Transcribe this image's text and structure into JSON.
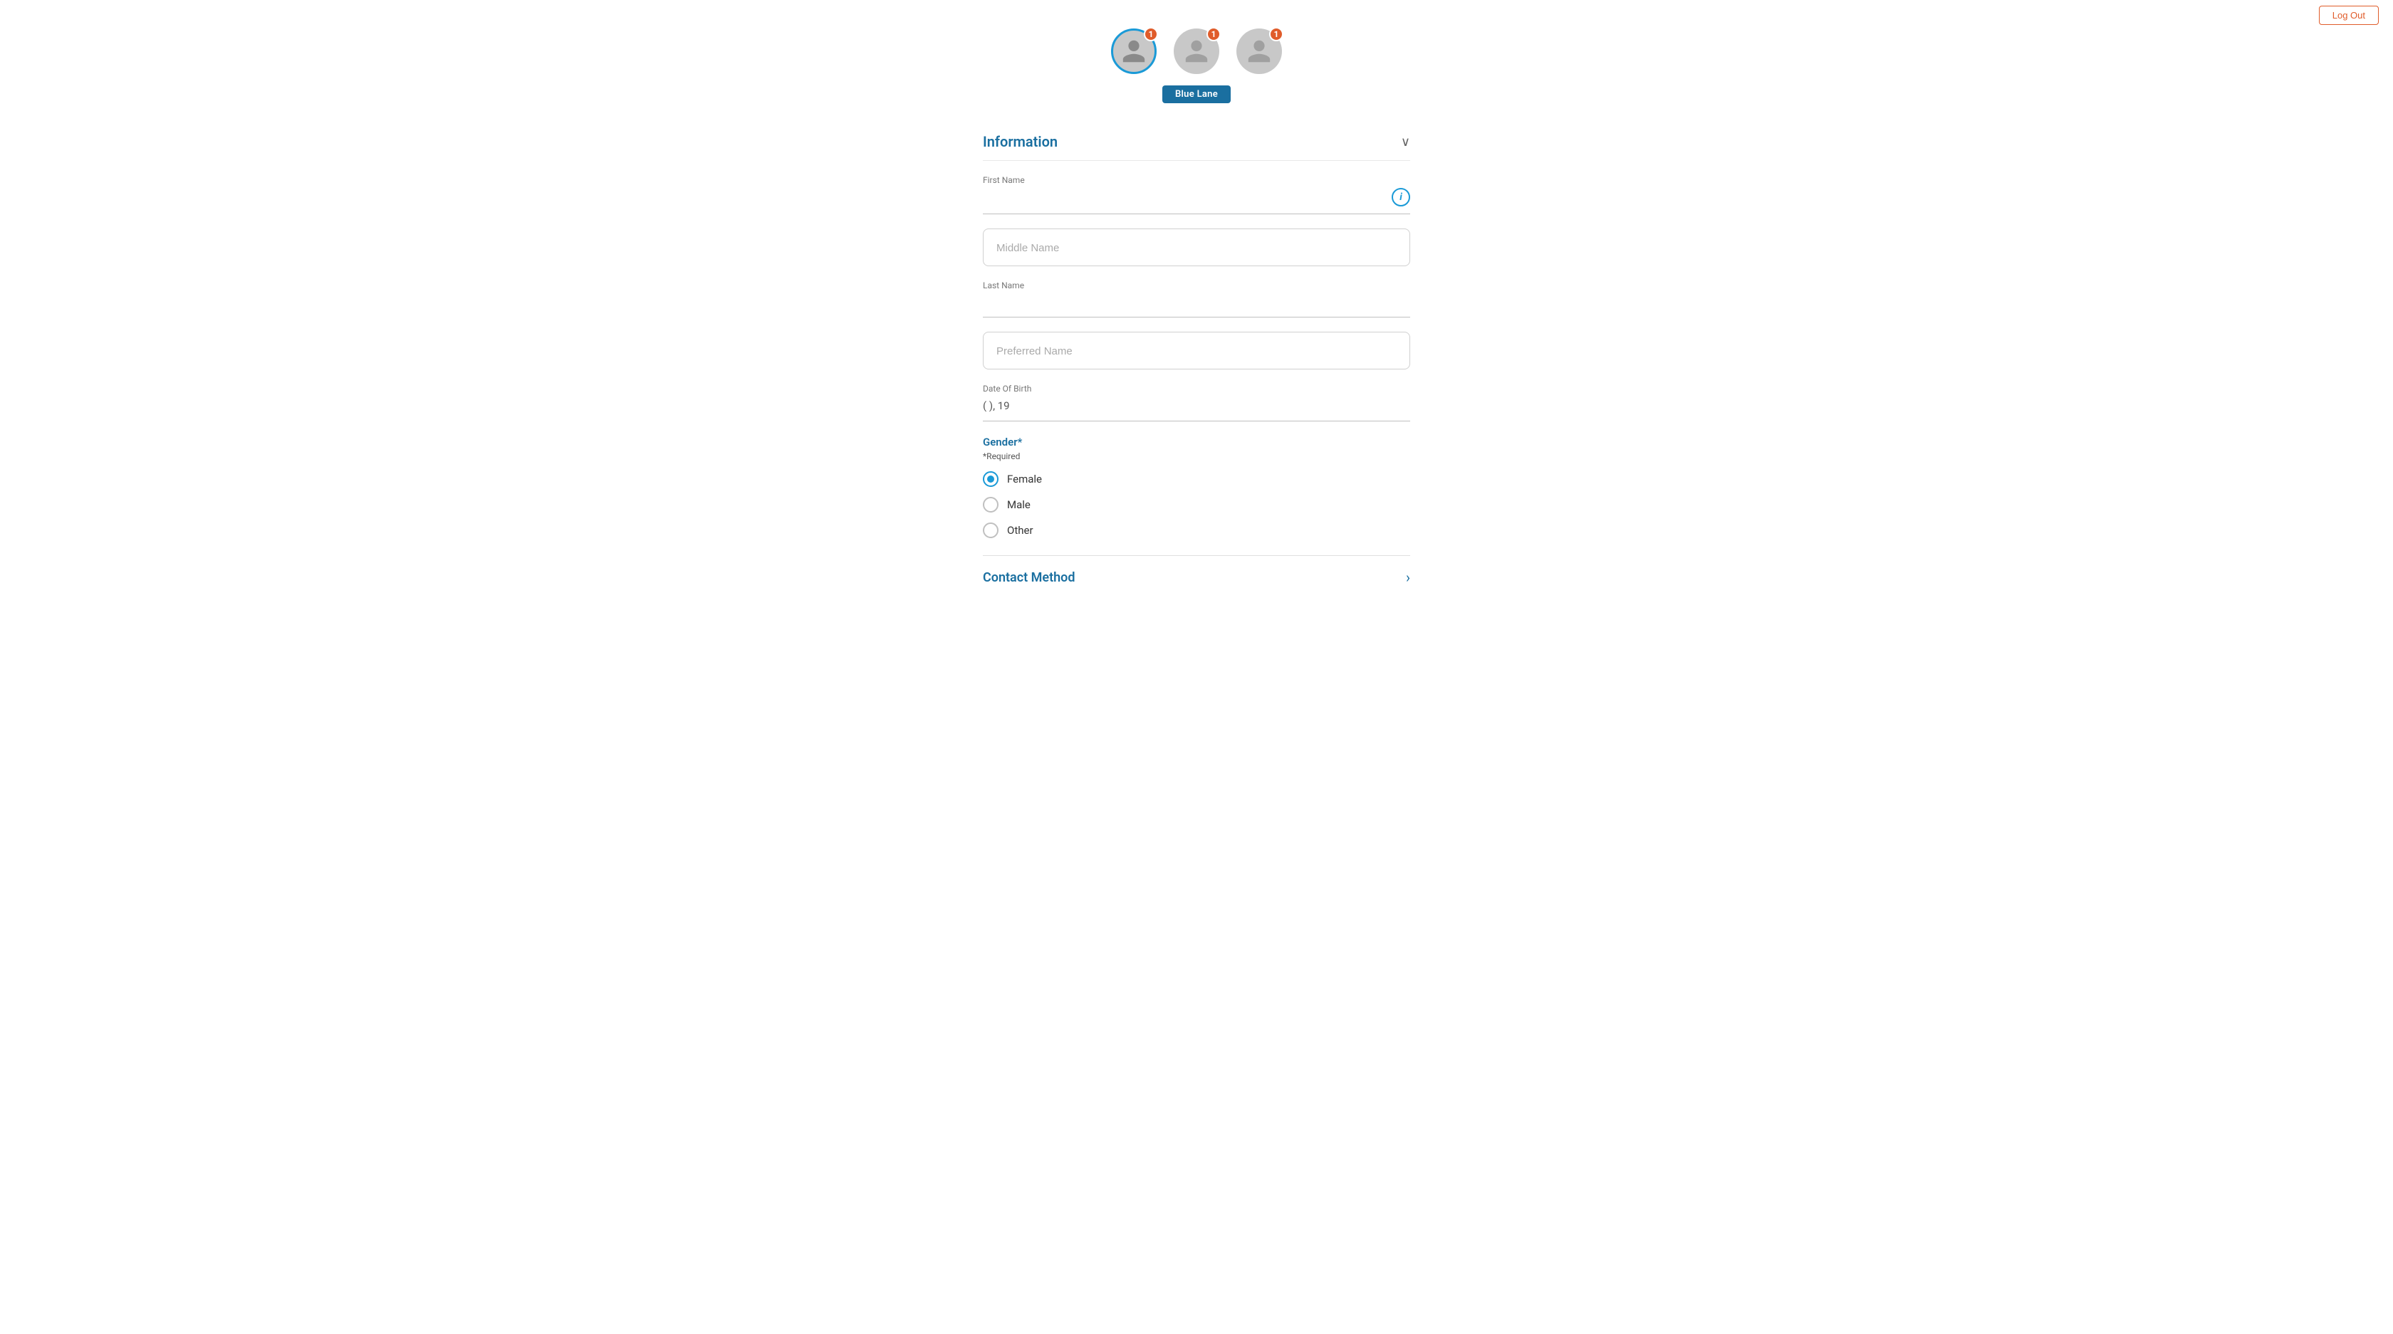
{
  "top_bar": {
    "logout_label": "Log Out"
  },
  "avatars": [
    {
      "id": "avatar-1",
      "active": true,
      "badge": "1"
    },
    {
      "id": "avatar-2",
      "active": false,
      "badge": "1"
    },
    {
      "id": "avatar-3",
      "active": false,
      "badge": "1"
    }
  ],
  "blue_lane_label": "Blue Lane",
  "information_section": {
    "title": "Information",
    "fields": {
      "first_name_label": "First Name",
      "first_name_placeholder": "",
      "middle_name_placeholder": "Middle Name",
      "last_name_label": "Last Name",
      "last_name_placeholder": "",
      "preferred_name_placeholder": "Preferred Name",
      "dob_label": "Date Of Birth",
      "dob_value": "( ), 19"
    },
    "gender": {
      "title": "Gender*",
      "required_note": "*Required",
      "options": [
        {
          "label": "Female",
          "selected": true
        },
        {
          "label": "Male",
          "selected": false
        },
        {
          "label": "Other",
          "selected": false
        }
      ]
    }
  },
  "contact_method": {
    "title": "Contact Method"
  },
  "icons": {
    "info": "i",
    "chevron_down": "∨",
    "chevron_right": "›"
  }
}
